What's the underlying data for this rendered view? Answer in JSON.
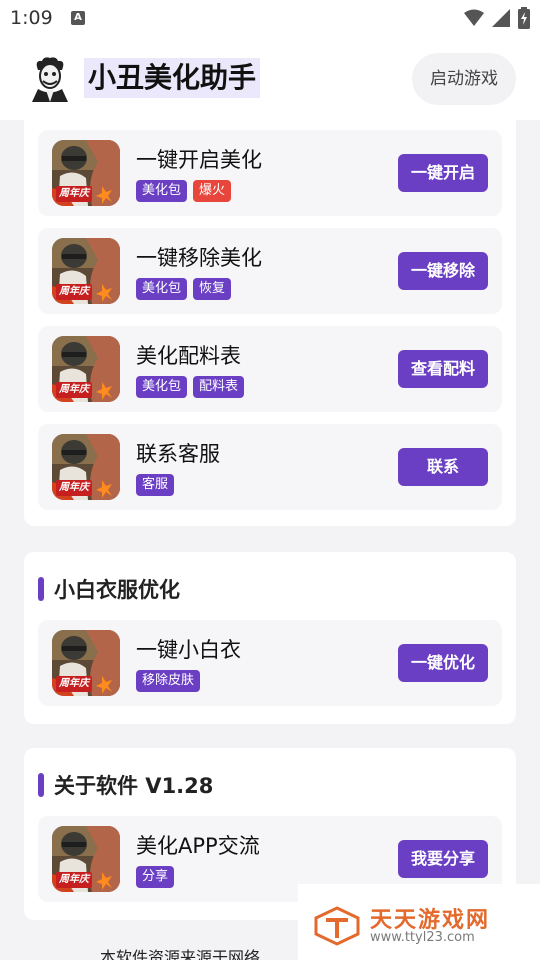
{
  "status_bar": {
    "time": "1:09",
    "notification_glyph": "A"
  },
  "app_bar": {
    "title": "小丑美化助手",
    "launch_button": "启动游戏"
  },
  "beautify_card": {
    "items": [
      {
        "title": "一键开启美化",
        "tags": [
          "美化包",
          "爆火"
        ],
        "button": "一键开启"
      },
      {
        "title": "一键移除美化",
        "tags": [
          "美化包",
          "恢复"
        ],
        "button": "一键移除"
      },
      {
        "title": "美化配料表",
        "tags": [
          "美化包",
          "配料表"
        ],
        "button": "查看配料"
      },
      {
        "title": "联系客服",
        "tags": [
          "客服"
        ],
        "button": "联系"
      }
    ]
  },
  "white_cloth_card": {
    "section_title": "小白衣服优化",
    "item": {
      "title": "一键小白衣",
      "tags": [
        "移除皮肤"
      ],
      "button": "一键优化"
    }
  },
  "about_card": {
    "section_title": "关于软件 V1.28",
    "item": {
      "title": "美化APP交流",
      "tags": [
        "分享"
      ],
      "button": "我要分享"
    }
  },
  "icon_badge": "周年庆",
  "footer": {
    "text": "本软件资源来源于网络"
  },
  "watermark": {
    "name": "天天游戏网",
    "url": "www.ttyl23.com"
  },
  "colors": {
    "accent": "#6a3fc4",
    "hot": "#e8463c",
    "watermark": "#e36a2c"
  }
}
